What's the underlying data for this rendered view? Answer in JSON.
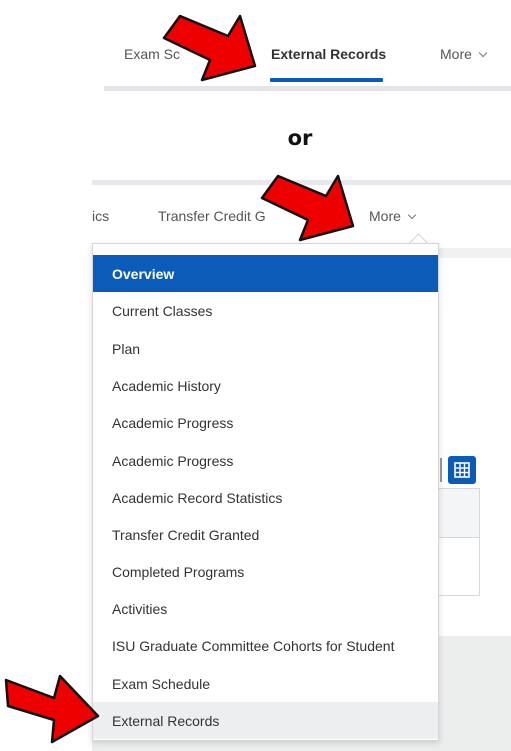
{
  "top_tabs": {
    "exam_schedule_label": "Exam Sc",
    "external_records_label": "External Records",
    "more_label": "More"
  },
  "or_label": "or",
  "second_tabs": {
    "partial_label": "ics",
    "transfer_label": "Transfer Credit G",
    "more_label": "More"
  },
  "dropdown": {
    "items": [
      {
        "label": "Overview",
        "state": "selected"
      },
      {
        "label": "Current Classes"
      },
      {
        "label": "Plan"
      },
      {
        "label": "Academic History"
      },
      {
        "label": "Academic Progress"
      },
      {
        "label": "Academic Progress"
      },
      {
        "label": "Academic Record Statistics"
      },
      {
        "label": "Transfer Credit Granted"
      },
      {
        "label": "Completed Programs"
      },
      {
        "label": "Activities"
      },
      {
        "label": "ISU Graduate Committee Cohorts for Student"
      },
      {
        "label": "Exam Schedule"
      },
      {
        "label": "External Records",
        "state": "hover"
      }
    ]
  },
  "icons": {
    "chevron": "chevron-down-icon",
    "grid": "grid-view-icon",
    "pointer": "red-arrow-icon"
  },
  "colors": {
    "accent_blue": "#0b5cb8",
    "arrow_red": "#ee0000",
    "hover_gray": "#eceef0"
  }
}
